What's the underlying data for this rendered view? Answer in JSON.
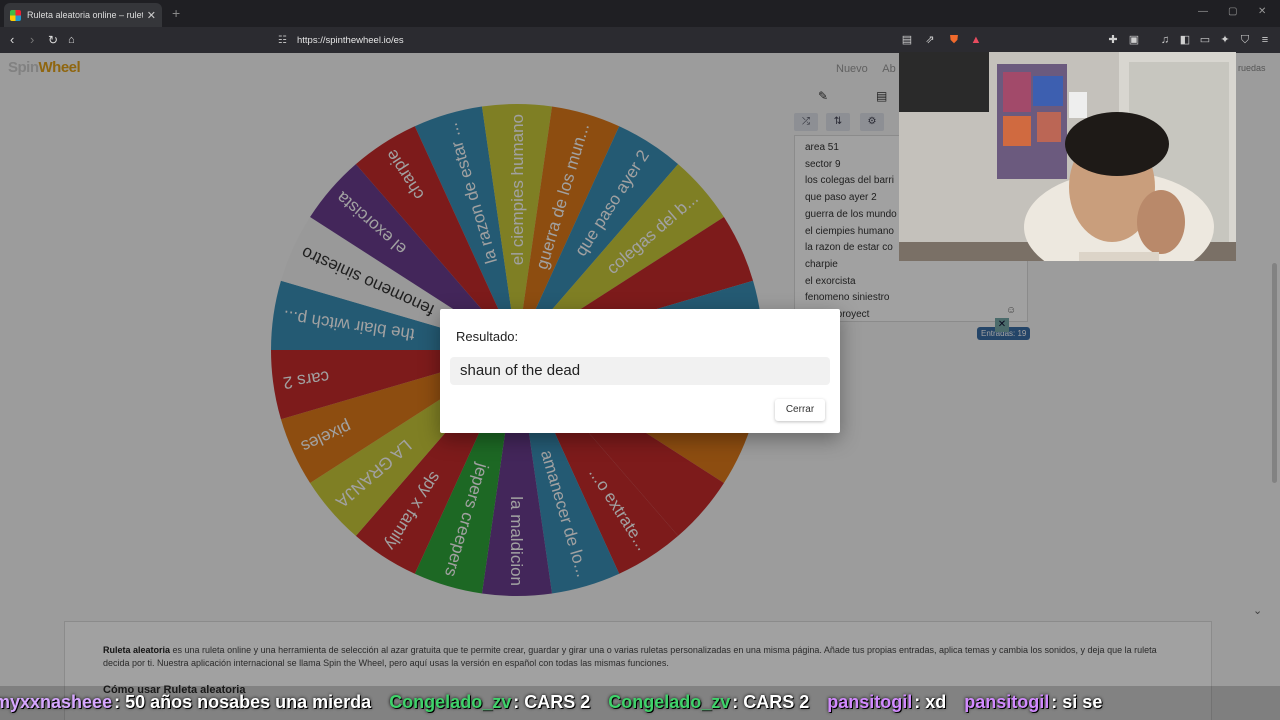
{
  "browser": {
    "tab_title": "Ruleta aleatoria online – ruleta d…",
    "tab_close": "✕",
    "new_tab": "+",
    "url": "https://spinthewheel.io/es",
    "window_controls": [
      "—",
      "▢",
      "✕"
    ]
  },
  "site": {
    "logo_main": "Spin",
    "logo_accent": "Wheel",
    "top_links": [
      "Nuevo",
      "Ab"
    ],
    "pruebas": "ruedas",
    "entries": [
      "area 51",
      "sector 9",
      "los colegas del barri",
      "que paso ayer 2",
      "guerra de los mundo",
      "el ciempies humano",
      "la razon de estar co",
      "charpie",
      "el exorcista",
      "fenomeno siniestro",
      "r witch proyect"
    ],
    "entries_count": "Entradas: 19",
    "ad_close": "✕",
    "info_bold": "Ruleta aleatoria",
    "info_text": " es una ruleta online y una herramienta de selección al azar gratuita que te permite crear, guardar y girar una o varias ruletas personalizadas en una misma página. Añade tus propias entradas, aplica temas y cambia los sonidos, y deja que la ruleta decida por ti. Nuestra aplicación internacional se llama Spin the Wheel, pero aquí usas la versión en español con todas las mismas funciones.",
    "info_heading": "Cómo usar Ruleta aleatoria"
  },
  "wheel": {
    "labels": [
      "la razon de estar ...",
      "el ciempies humano",
      "guerra de los mun...",
      "que paso ayer 2",
      "colegas del b...",
      "",
      "",
      "",
      "",
      "",
      "...o extrate...",
      "amanecer de lo...",
      "la maldicion",
      "jepers creepers",
      "spy x family",
      "LA GRANJA",
      "pixeles",
      "cars 2",
      "the blair witch p...",
      "fenomeno siniestro",
      "el exorcista",
      "charpie"
    ],
    "colors": [
      "#3a8fb7",
      "#c9c93a",
      "#e07b1a",
      "#3a8fb7",
      "#c9c93a",
      "#c62b2b",
      "#3a8fb7",
      "#c9c93a",
      "#e07b1a",
      "#c62b2b",
      "#c62b2b",
      "#3a8fb7",
      "#6a3d8f",
      "#2fa53a",
      "#c62b2b",
      "#c9c93a",
      "#e07b1a",
      "#c62b2b",
      "#3a8fb7",
      "#f2f2f2",
      "#6a3d8f",
      "#c62b2b"
    ]
  },
  "dialog": {
    "title": "Resultado:",
    "result": "shaun of the dead",
    "close_label": "Cerrar"
  },
  "ticker": {
    "messages": [
      {
        "user": "myxxnasheee",
        "text": ": 50 años nosabes una mierda"
      },
      {
        "user": "Congelado_zv",
        "text": ": CARS 2"
      },
      {
        "user": "Congelado_zv",
        "text": ": CARS 2"
      },
      {
        "user": "pansitogil",
        "text": ": xd"
      },
      {
        "user": "pansitogil",
        "text": ": si se"
      }
    ]
  }
}
